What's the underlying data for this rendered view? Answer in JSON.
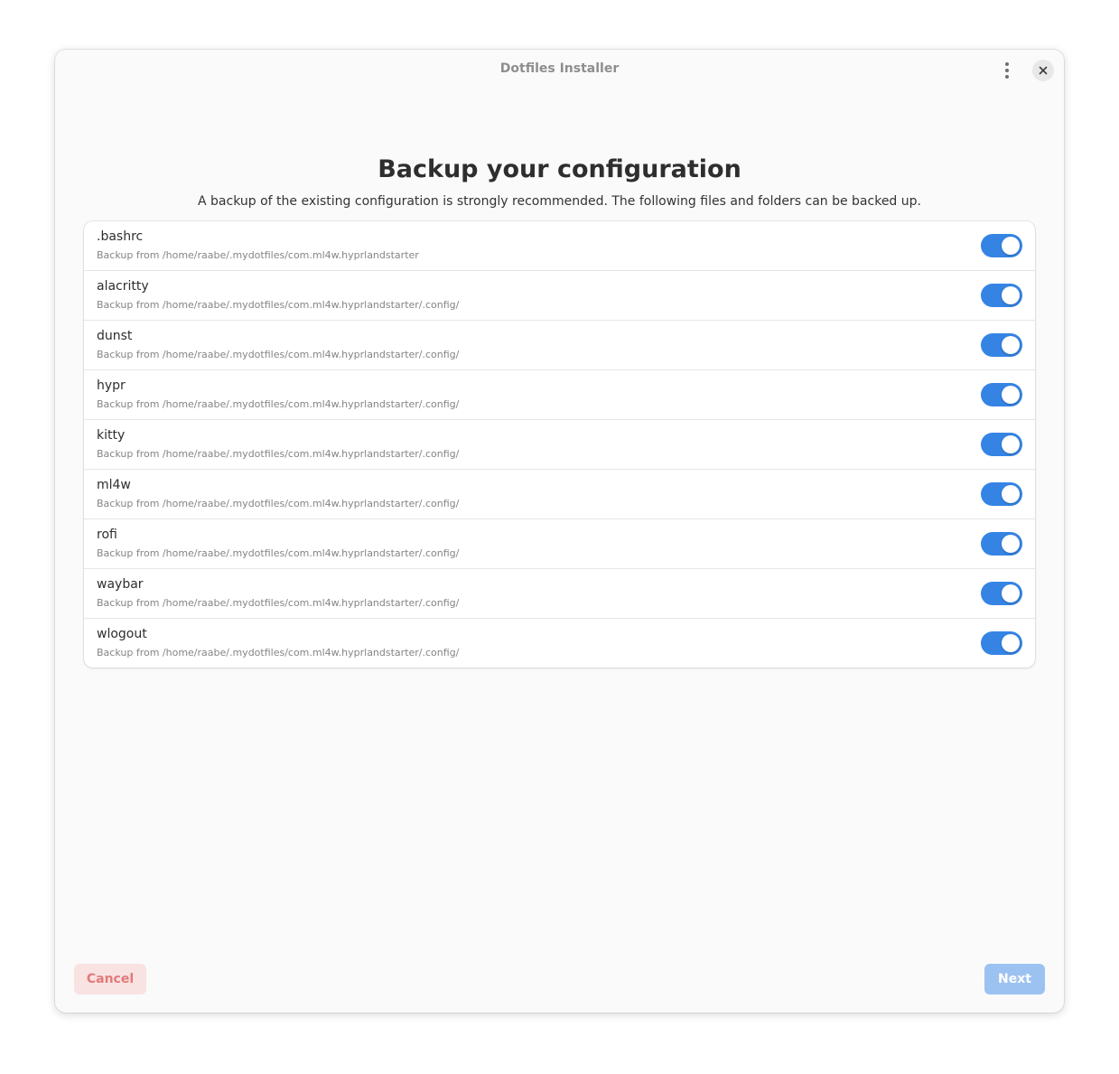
{
  "window": {
    "title": "Dotfiles Installer"
  },
  "icons": {
    "menu": "vertical-ellipsis-icon",
    "close": "close-icon"
  },
  "page": {
    "heading": "Backup your configuration",
    "description": "A backup of the existing configuration is strongly recommended. The following files and folders can be backed up."
  },
  "items": [
    {
      "name": ".bashrc",
      "source": "Backup from /home/raabe/.mydotfiles/com.ml4w.hyprlandstarter",
      "enabled": true
    },
    {
      "name": "alacritty",
      "source": "Backup from /home/raabe/.mydotfiles/com.ml4w.hyprlandstarter/.config/",
      "enabled": true
    },
    {
      "name": "dunst",
      "source": "Backup from /home/raabe/.mydotfiles/com.ml4w.hyprlandstarter/.config/",
      "enabled": true
    },
    {
      "name": "hypr",
      "source": "Backup from /home/raabe/.mydotfiles/com.ml4w.hyprlandstarter/.config/",
      "enabled": true
    },
    {
      "name": "kitty",
      "source": "Backup from /home/raabe/.mydotfiles/com.ml4w.hyprlandstarter/.config/",
      "enabled": true
    },
    {
      "name": "ml4w",
      "source": "Backup from /home/raabe/.mydotfiles/com.ml4w.hyprlandstarter/.config/",
      "enabled": true
    },
    {
      "name": "rofi",
      "source": "Backup from /home/raabe/.mydotfiles/com.ml4w.hyprlandstarter/.config/",
      "enabled": true
    },
    {
      "name": "waybar",
      "source": "Backup from /home/raabe/.mydotfiles/com.ml4w.hyprlandstarter/.config/",
      "enabled": true
    },
    {
      "name": "wlogout",
      "source": "Backup from /home/raabe/.mydotfiles/com.ml4w.hyprlandstarter/.config/",
      "enabled": true
    }
  ],
  "footer": {
    "cancel_label": "Cancel",
    "next_label": "Next"
  },
  "colors": {
    "accent": "#3584e4",
    "destructive": "#e27a7a"
  }
}
